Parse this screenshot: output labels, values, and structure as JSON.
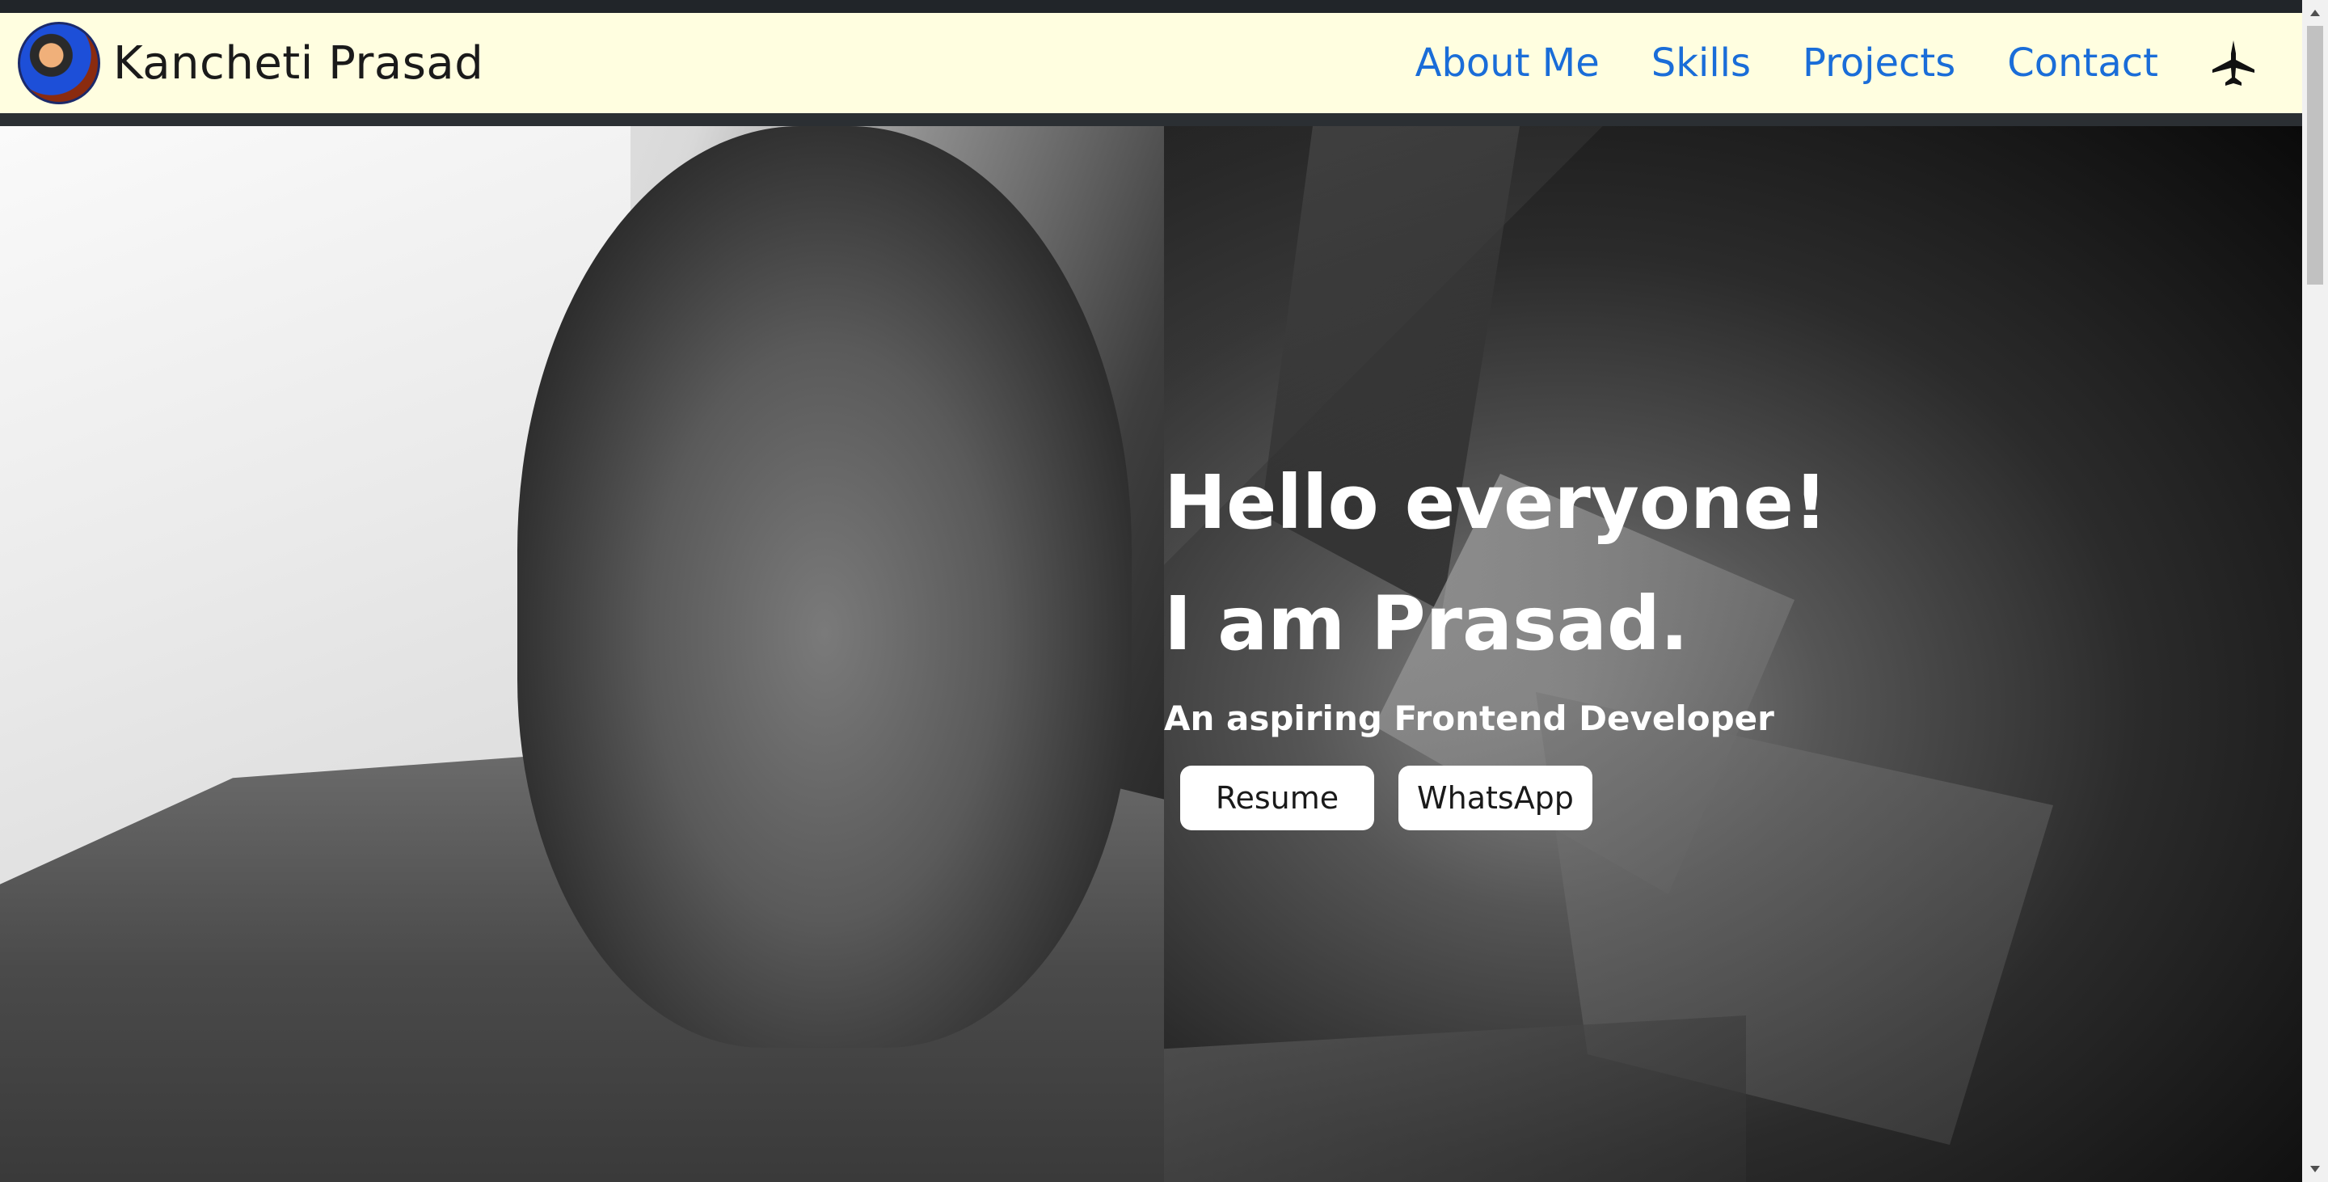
{
  "navbar": {
    "brand_name": "Kancheti Prasad",
    "avatar_icon": "profile-avatar",
    "links": [
      {
        "label": "About Me"
      },
      {
        "label": "Skills"
      },
      {
        "label": "Projects"
      },
      {
        "label": "Contact"
      }
    ],
    "theme_icon": "fighter-jet-icon",
    "colors": {
      "background": "#fffee0",
      "link": "#1a6dd8"
    }
  },
  "hero": {
    "greeting": "Hello everyone!",
    "intro": "I am Prasad.",
    "tagline": "An aspiring Frontend Developer",
    "buttons": {
      "resume": "Resume",
      "whatsapp": "WhatsApp"
    }
  }
}
